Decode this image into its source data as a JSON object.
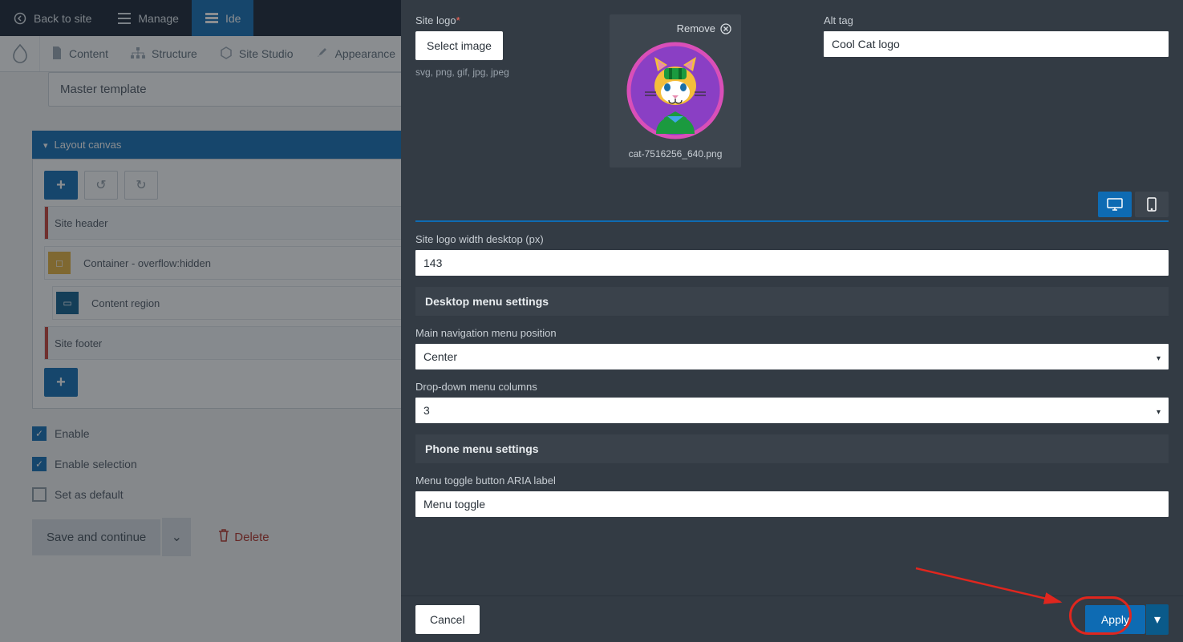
{
  "adminbar": {
    "back": "Back to site",
    "manage": "Manage",
    "ide": "Ide"
  },
  "secnav": {
    "content": "Content",
    "structure": "Structure",
    "sitestudio": "Site Studio",
    "appearance": "Appearance"
  },
  "main": {
    "master_template": "Master template",
    "layout_canvas": "Layout canvas",
    "items": {
      "site_header": "Site header",
      "container": "Container - overflow:hidden",
      "content_region": "Content region",
      "site_footer": "Site footer"
    },
    "checks": {
      "enable": "Enable",
      "enable_selection": "Enable selection",
      "set_default": "Set as default"
    },
    "save": "Save and continue",
    "delete": "Delete"
  },
  "panel": {
    "site_logo_label": "Site logo",
    "select_image": "Select image",
    "formats_hint": "svg, png, gif, jpg, jpeg",
    "remove": "Remove",
    "logo_filename": "cat-7516256_640.png",
    "alt_label": "Alt tag",
    "alt_value": "Cool Cat logo",
    "width_label": "Site logo width desktop (px)",
    "width_value": "143",
    "desktop_section": "Desktop menu settings",
    "nav_pos_label": "Main navigation menu position",
    "nav_pos_value": "Center",
    "dd_cols_label": "Drop-down menu columns",
    "dd_cols_value": "3",
    "phone_section": "Phone menu settings",
    "aria_label": "Menu toggle button ARIA label",
    "aria_value": "Menu toggle",
    "cancel": "Cancel",
    "apply": "Apply"
  }
}
